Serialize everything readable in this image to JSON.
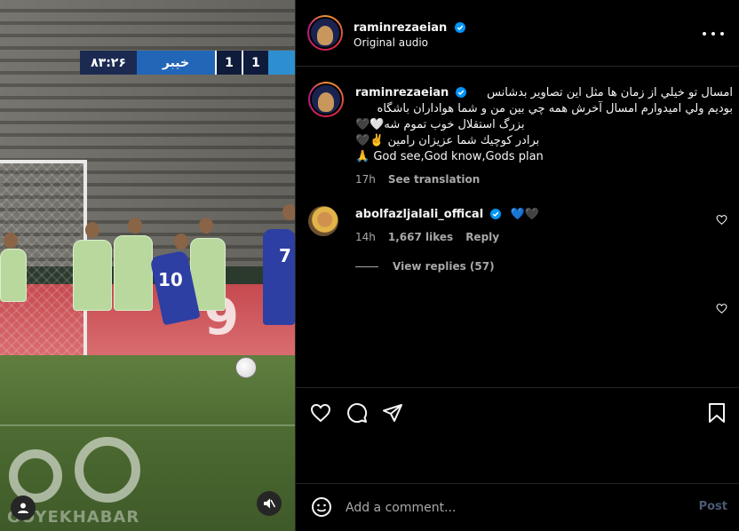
{
  "video": {
    "scoreboard": {
      "time": "۸۳:۲۶",
      "team": "خیبر",
      "score_a": "1",
      "score_b": "1"
    },
    "adboard_text": "9",
    "jersey_number_a": "10",
    "jersey_number_b": "7",
    "watermark_text": "GOYEKHABAR"
  },
  "post": {
    "author": {
      "username": "raminrezaeian",
      "verified": true
    },
    "audio_label": "Original audio",
    "caption": {
      "username": "raminrezaeian",
      "lines": [
        "امسال تو خيلي از زمان ها مثل اين تصاوير بدشانس",
        "بوديم ولي اميدوارم امسال آخرش همه چي بين من و شما هواداران باشگاه",
        "بزرگ استقلال خوب تموم شه🤍🖤",
        "برادر کوچيك شما عزيزان رامين ✌️🖤",
        "🙏 God see,God know,Gods plan"
      ],
      "time": "17h",
      "translate": "See translation"
    },
    "comments": [
      {
        "username": "abolfazljalali_offical",
        "verified": true,
        "text": "💙🖤",
        "time": "14h",
        "likes": "1,667 likes",
        "reply": "Reply",
        "view_replies": "View replies (57)"
      }
    ],
    "add_comment_placeholder": "Add a comment...",
    "post_label": "Post"
  },
  "colors": {
    "background": "#000000",
    "text": "#f5f5f5",
    "muted": "#a8a8a8",
    "verified": "#0095f6",
    "post_disabled": "#4c5a75"
  }
}
